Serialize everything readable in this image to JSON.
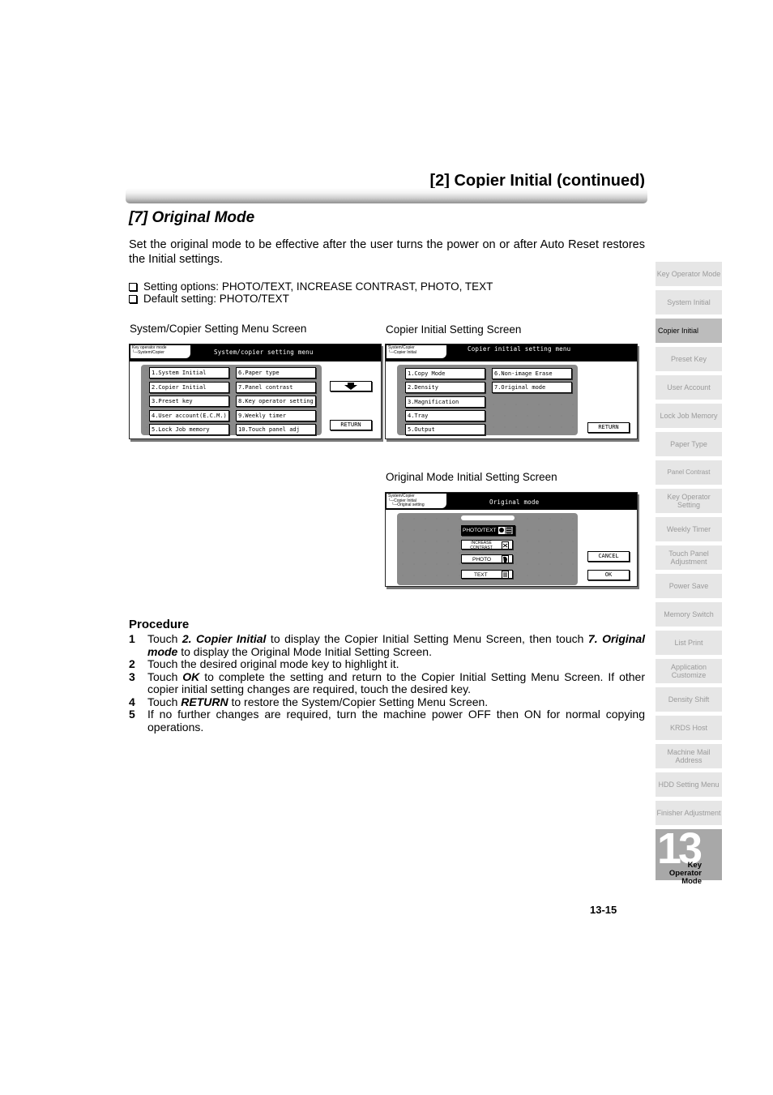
{
  "header": {
    "section_title": "[2] Copier Initial (continued)",
    "subsection_title": "[7] Original Mode",
    "intro": "Set the original mode to be effective after the user turns the power on or after Auto Reset restores the Initial settings.",
    "bullets": [
      "Setting options: PHOTO/TEXT, INCREASE CONTRAST, PHOTO, TEXT",
      "Default setting: PHOTO/TEXT"
    ]
  },
  "figures": {
    "system_copier": {
      "caption": "System/Copier Setting Menu Screen",
      "breadcrumb": "Key operator mode\n└─System/Copier",
      "title": "System/copier setting menu",
      "left_keys": [
        "1.System Initial",
        "2.Copier Initial",
        "3.Preset key",
        "4.User account(E.C.M.)",
        "5.Lock Job memory"
      ],
      "right_keys": [
        "6.Paper type",
        "7.Panel contrast",
        "8.Key operator setting",
        "9.Weekly timer",
        "10.Touch panel adj"
      ],
      "next_icon": "down-arrow-icon",
      "return_label": "RETURN"
    },
    "copier_initial": {
      "caption": "Copier Initial Setting Screen",
      "breadcrumb": "System/Copier\n└─Copier Initial",
      "title": "Copier initial setting menu",
      "left_keys": [
        "1.Copy Mode",
        "2.Density",
        "3.Magnification",
        "4.Tray",
        "5.Output"
      ],
      "right_keys": [
        "6.Non-image Erase",
        "7.Original mode"
      ],
      "return_label": "RETURN"
    },
    "original_mode": {
      "caption": "Original Mode Initial Setting Screen",
      "breadcrumb": "System/Copier\n└─Copier Initial\n   └─Original setting",
      "title": "Original mode",
      "options": [
        {
          "label": "PHOTO/TEXT",
          "icon": "photo-text-icon",
          "selected": true
        },
        {
          "label": "INCREASE CONTRAST",
          "icon": "contrast-icon",
          "selected": false
        },
        {
          "label": "PHOTO",
          "icon": "photo-icon",
          "selected": false
        },
        {
          "label": "TEXT",
          "icon": "text-icon",
          "selected": false
        }
      ],
      "cancel_label": "CANCEL",
      "ok_label": "OK"
    }
  },
  "procedure": {
    "title": "Procedure",
    "steps": [
      {
        "n": "1",
        "parts": [
          "Touch ",
          "2. Copier Initial",
          " to display the Copier Initial Setting Menu Screen, then touch ",
          "7. Original mode",
          " to display the Original Mode Initial Setting Screen."
        ]
      },
      {
        "n": "2",
        "text": "Touch the desired original mode key to highlight it."
      },
      {
        "n": "3",
        "parts": [
          "Touch ",
          "OK",
          " to complete the setting and return to the Copier Initial Setting Menu Screen. If other copier initial setting changes are required, touch the desired key."
        ]
      },
      {
        "n": "4",
        "parts": [
          "Touch ",
          "RETURN",
          " to restore the System/Copier Setting Menu Screen."
        ]
      },
      {
        "n": "5",
        "text": "If no further changes are required, turn the machine power OFF then ON for normal copying operations."
      }
    ]
  },
  "side_tabs": [
    {
      "label": "Key Operator Mode",
      "active": false
    },
    {
      "label": "System Initial",
      "active": false
    },
    {
      "label": "Copier Initial",
      "active": true
    },
    {
      "label": "Preset Key",
      "active": false
    },
    {
      "label": "User Account",
      "active": false
    },
    {
      "label": "Lock Job Memory",
      "active": false
    },
    {
      "label": "Paper Type",
      "active": false
    },
    {
      "label": "Panel Contrast",
      "active": false
    },
    {
      "label": "Key Operator Setting",
      "active": false
    },
    {
      "label": "Weekly Timer",
      "active": false
    },
    {
      "label": "Touch Panel Adjustment",
      "active": false
    },
    {
      "label": "Power Save",
      "active": false
    },
    {
      "label": "Memory Switch",
      "active": false
    },
    {
      "label": "List Print",
      "active": false
    },
    {
      "label": "Application Customize",
      "active": false
    },
    {
      "label": "Density Shift",
      "active": false
    },
    {
      "label": "KRDS Host",
      "active": false
    },
    {
      "label": "Machine Mail Address",
      "active": false
    },
    {
      "label": "HDD Setting Menu",
      "active": false
    },
    {
      "label": "Finisher Adjustment",
      "active": false
    }
  ],
  "chapter": {
    "number": "13",
    "label": "Key Operator Mode"
  },
  "footer": {
    "page_number": "13-15"
  }
}
